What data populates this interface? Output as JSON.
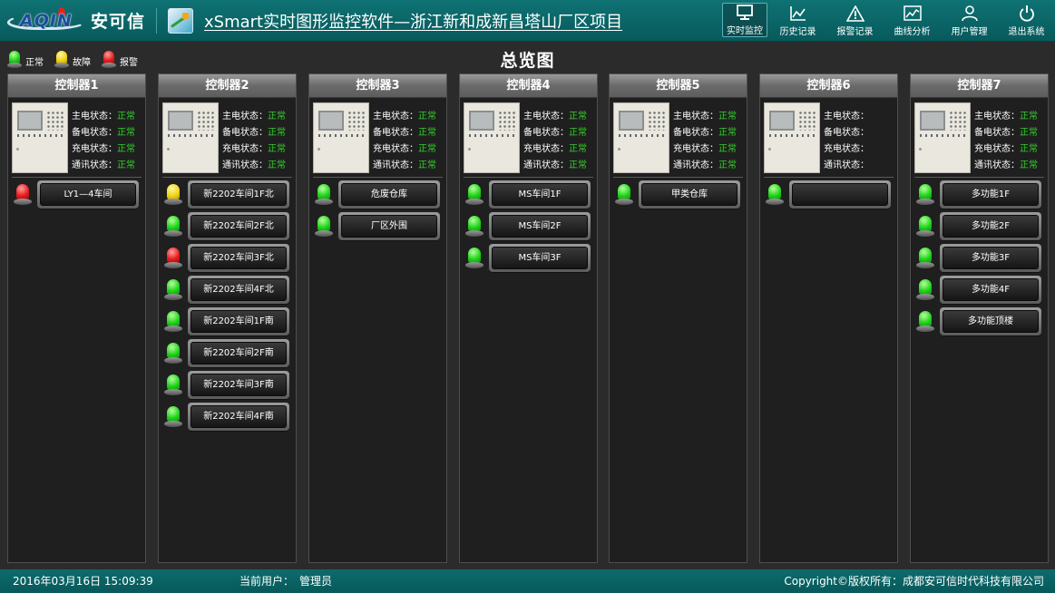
{
  "header": {
    "logo_text": "AQIN",
    "brand": "安可信",
    "title": "xSmart实时图形监控软件—浙江新和成新昌塔山厂区项目",
    "nav": [
      {
        "label": "实时监控",
        "icon": "monitor-icon",
        "active": true
      },
      {
        "label": "历史记录",
        "icon": "history-chart-icon",
        "active": false
      },
      {
        "label": "报警记录",
        "icon": "warning-icon",
        "active": false
      },
      {
        "label": "曲线分析",
        "icon": "curve-chart-icon",
        "active": false
      },
      {
        "label": "用户管理",
        "icon": "user-icon",
        "active": false
      },
      {
        "label": "退出系统",
        "icon": "power-icon",
        "active": false
      }
    ]
  },
  "legend": [
    {
      "label": "正常",
      "color": "green"
    },
    {
      "label": "故障",
      "color": "yellow"
    },
    {
      "label": "报警",
      "color": "red"
    }
  ],
  "page_title": "总览图",
  "status_keys": [
    "主电状态：",
    "备电状态：",
    "充电状态：",
    "通讯状态："
  ],
  "controllers": [
    {
      "name": "控制器1",
      "status": [
        "正常",
        "正常",
        "正常",
        "正常"
      ],
      "zones": [
        {
          "label": "LY1—4车间",
          "lamp": "red"
        }
      ]
    },
    {
      "name": "控制器2",
      "status": [
        "正常",
        "正常",
        "正常",
        "正常"
      ],
      "zones": [
        {
          "label": "新2202车间1F北",
          "lamp": "yellow"
        },
        {
          "label": "新2202车间2F北",
          "lamp": "green"
        },
        {
          "label": "新2202车间3F北",
          "lamp": "red"
        },
        {
          "label": "新2202车间4F北",
          "lamp": "green"
        },
        {
          "label": "新2202车间1F南",
          "lamp": "green"
        },
        {
          "label": "新2202车间2F南",
          "lamp": "green"
        },
        {
          "label": "新2202车间3F南",
          "lamp": "green"
        },
        {
          "label": "新2202车间4F南",
          "lamp": "green"
        }
      ]
    },
    {
      "name": "控制器3",
      "status": [
        "正常",
        "正常",
        "正常",
        "正常"
      ],
      "zones": [
        {
          "label": "危废仓库",
          "lamp": "green"
        },
        {
          "label": "厂区外围",
          "lamp": "green"
        }
      ]
    },
    {
      "name": "控制器4",
      "status": [
        "正常",
        "正常",
        "正常",
        "正常"
      ],
      "zones": [
        {
          "label": "MS车间1F",
          "lamp": "green"
        },
        {
          "label": "MS车间2F",
          "lamp": "green"
        },
        {
          "label": "MS车间3F",
          "lamp": "green"
        }
      ]
    },
    {
      "name": "控制器5",
      "status": [
        "正常",
        "正常",
        "正常",
        "正常"
      ],
      "zones": [
        {
          "label": "甲类仓库",
          "lamp": "green"
        }
      ]
    },
    {
      "name": "控制器6",
      "status": [
        "",
        "",
        "",
        ""
      ],
      "zones": [
        {
          "label": "",
          "lamp": "green"
        }
      ]
    },
    {
      "name": "控制器7",
      "status": [
        "正常",
        "正常",
        "正常",
        "正常"
      ],
      "zones": [
        {
          "label": "多功能1F",
          "lamp": "green"
        },
        {
          "label": "多功能2F",
          "lamp": "green"
        },
        {
          "label": "多功能3F",
          "lamp": "green"
        },
        {
          "label": "多功能4F",
          "lamp": "green"
        },
        {
          "label": "多功能顶楼",
          "lamp": "green"
        }
      ]
    }
  ],
  "footer": {
    "datetime": "2016年03月16日 15:09:39",
    "user_label": "当前用户：",
    "user_value": "管理员",
    "copyright": "Copyright©版权所有：成都安可信时代科技有限公司"
  }
}
